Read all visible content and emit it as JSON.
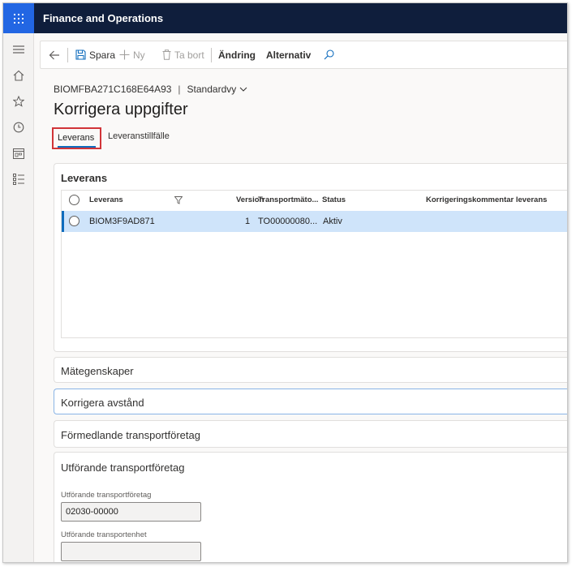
{
  "app": {
    "title": "Finance and Operations"
  },
  "icons": {
    "waffle": "waffle-icon",
    "hamburger": "hamburger-icon",
    "home": "home-icon",
    "favorites": "star-icon",
    "recent": "clock-icon",
    "workspaces": "workspace-icon",
    "modules": "list-icon"
  },
  "actions": {
    "save": "Spara",
    "new": "Ny",
    "delete": "Ta bort",
    "edit": "Ändring",
    "options": "Alternativ"
  },
  "header": {
    "record_id": "BIOMFBA271C168E64A93",
    "separator": "|",
    "view": "Standardvy",
    "title": "Korrigera uppgifter"
  },
  "tabs": [
    {
      "label": "Leverans",
      "active": true
    },
    {
      "label": "Leveranstillfälle",
      "active": false
    }
  ],
  "leverans": {
    "title": "Leverans",
    "columns": [
      "Leverans",
      "Version",
      "Transportmäto...",
      "Status",
      "Korrigeringskommentar leverans"
    ],
    "rows": [
      {
        "leverans": "BIOM3F9AD871",
        "version": "1",
        "transport": "TO00000080...",
        "status": "Aktiv",
        "kommentar": ""
      }
    ]
  },
  "sections": {
    "metegenskaper": "Mätegenskaper",
    "korrigera": "Korrigera avstånd",
    "formedlande": "Förmedlande transportföretag",
    "utforande": "Utförande transportföretag"
  },
  "utforande_fields": {
    "company_label": "Utförande transportföretag",
    "company_value": "02030-00000",
    "unit_label": "Utförande transportenhet",
    "unit_value": ""
  },
  "colors": {
    "topbar": "#0f1e3c",
    "waffle": "#2266e3",
    "accent": "#0f6cbd",
    "highlight_border": "#d13438",
    "selected_row": "#cfe4fa"
  }
}
